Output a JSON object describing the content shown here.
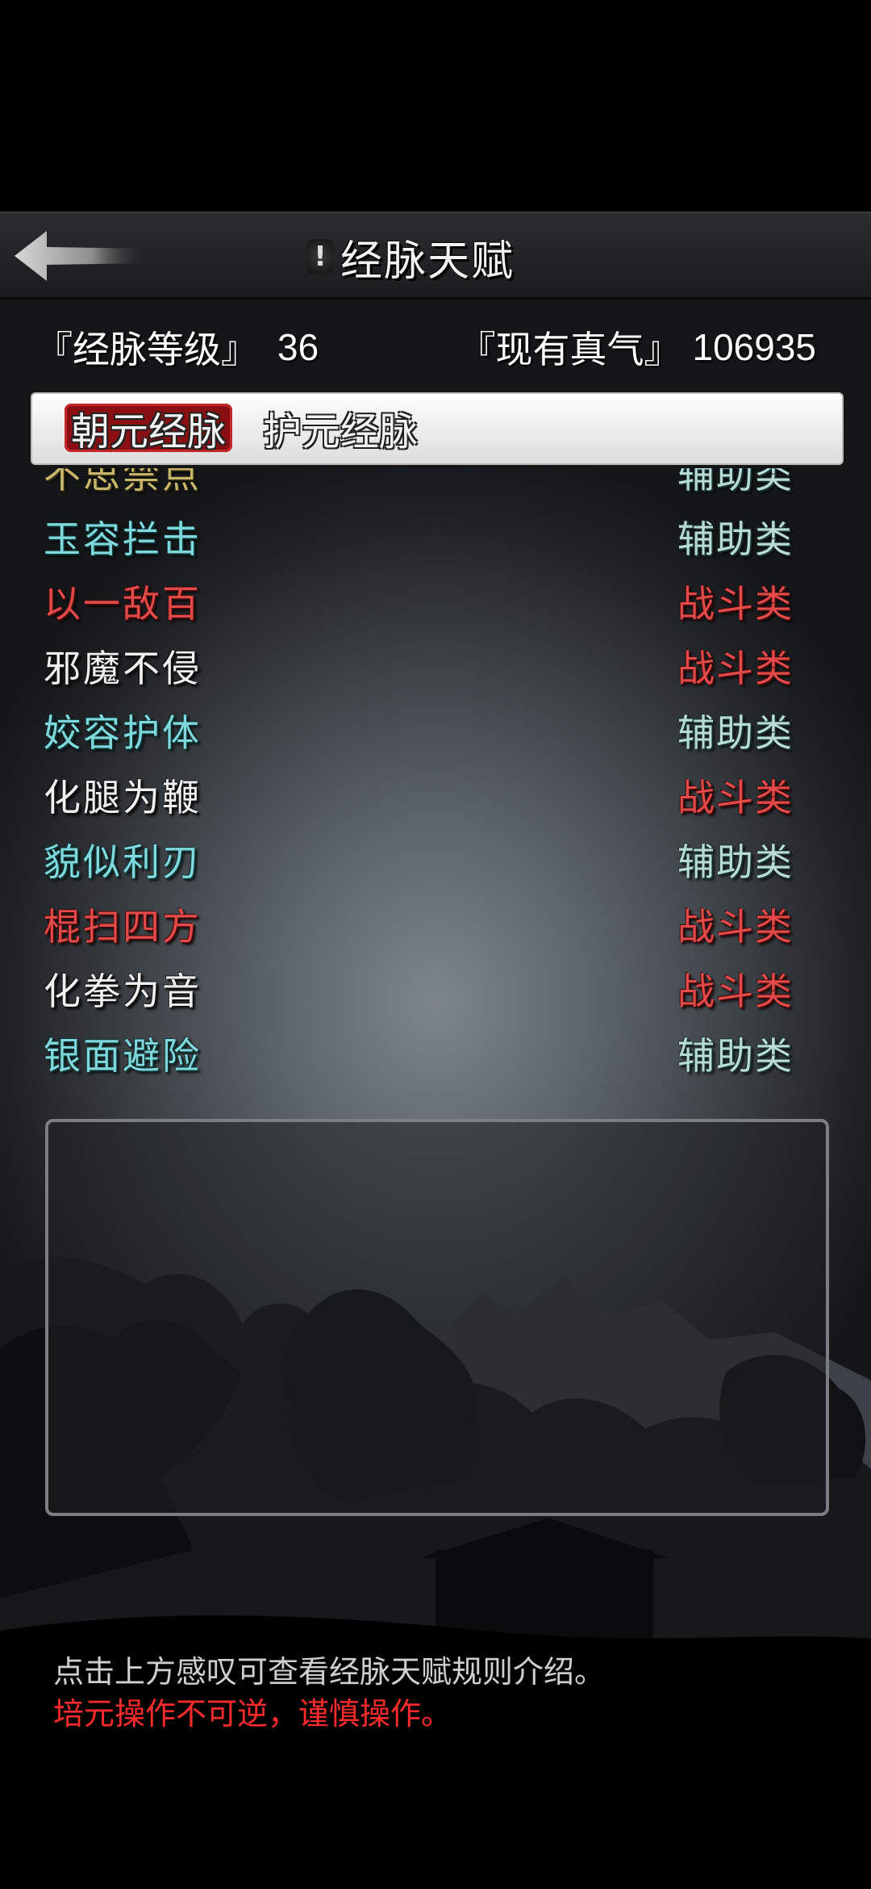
{
  "header": {
    "title": "经脉天赋",
    "info_icon_glyph": "!"
  },
  "stats": {
    "level_label": "『经脉等级』",
    "level_value": "36",
    "qi_label": "『现有真气』",
    "qi_value": "106935"
  },
  "tabs": [
    {
      "label": "朝元经脉",
      "active": true
    },
    {
      "label": "护元经脉",
      "active": false
    }
  ],
  "talents": [
    {
      "name": "不思禁点",
      "category": "辅助类",
      "name_color": "gold",
      "cat_color": "teal"
    },
    {
      "name": "玉容拦击",
      "category": "辅助类",
      "name_color": "cyan",
      "cat_color": "teal"
    },
    {
      "name": "以一敌百",
      "category": "战斗类",
      "name_color": "red",
      "cat_color": "red"
    },
    {
      "name": "邪魔不侵",
      "category": "战斗类",
      "name_color": "white",
      "cat_color": "red"
    },
    {
      "name": "姣容护体",
      "category": "辅助类",
      "name_color": "cyan",
      "cat_color": "teal"
    },
    {
      "name": "化腿为鞭",
      "category": "战斗类",
      "name_color": "white",
      "cat_color": "red"
    },
    {
      "name": "貌似利刃",
      "category": "辅助类",
      "name_color": "cyan",
      "cat_color": "teal"
    },
    {
      "name": "棍扫四方",
      "category": "战斗类",
      "name_color": "red",
      "cat_color": "red"
    },
    {
      "name": "化拳为音",
      "category": "战斗类",
      "name_color": "white",
      "cat_color": "red"
    },
    {
      "name": "银面避险",
      "category": "辅助类",
      "name_color": "cyan",
      "cat_color": "teal"
    }
  ],
  "notes": {
    "hint": "点击上方感叹可查看经脉天赋规则介绍。",
    "warning": "培元操作不可逆，谨慎操作。"
  },
  "colors": {
    "accent_red": "#8a0f12",
    "warning_red": "#ff2b2b"
  }
}
